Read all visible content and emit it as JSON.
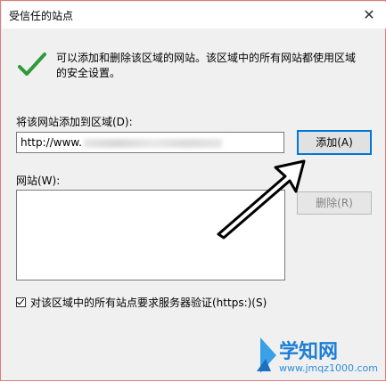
{
  "window": {
    "title": "受信任的站点",
    "close_glyph": "✕"
  },
  "info": {
    "description": "可以添加和删除该区域的网站。该区域中的所有网站都使用区域的安全设置。",
    "check_icon": "checkmark-icon"
  },
  "add_section": {
    "label": "将该网站添加到区域(D):",
    "url_value": "http://www.",
    "add_button": "添加(A)"
  },
  "sites_section": {
    "label": "网站(W):",
    "remove_button": "删除(R)"
  },
  "https_option": {
    "label": "对该区域中的所有站点要求服务器验证(https:)(S)",
    "checked": true
  },
  "watermark": {
    "brand": "学知网",
    "url": "www.jmqz1000.com"
  },
  "colors": {
    "accent": "#0078d7",
    "check_green": "#2c9b3b",
    "watermark_blue": "#1e7fd6"
  }
}
